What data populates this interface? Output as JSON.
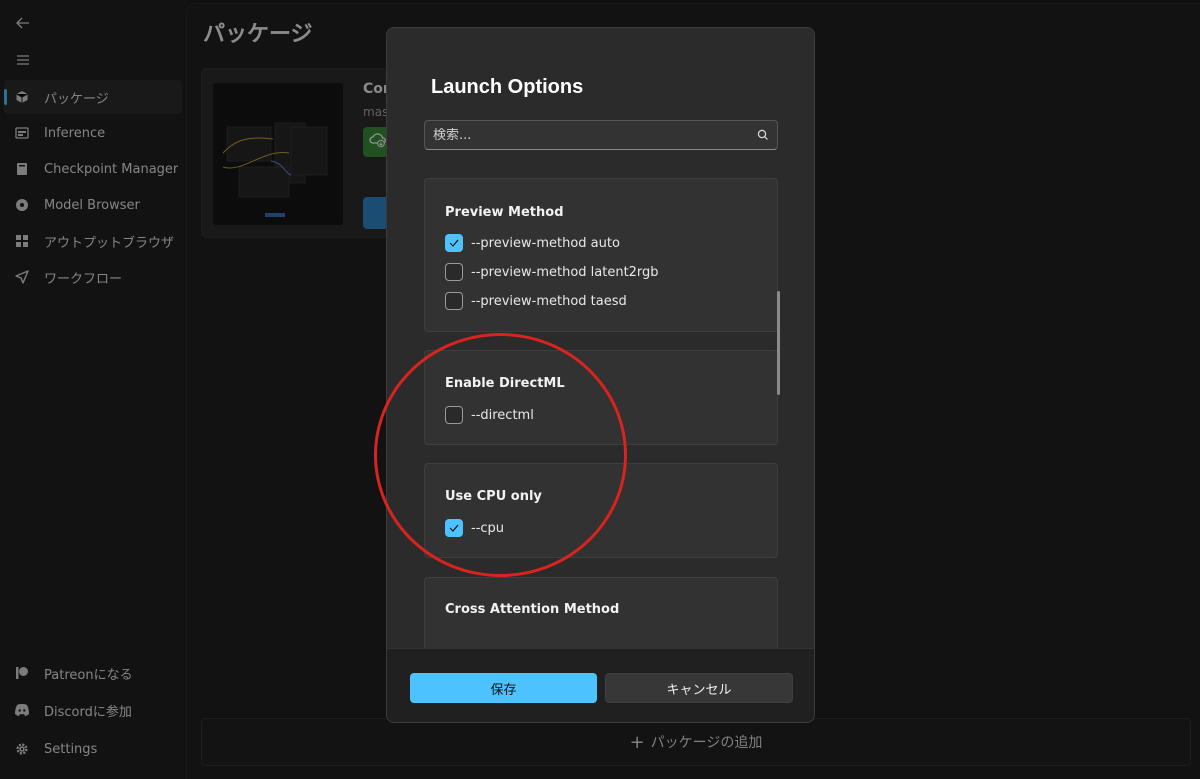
{
  "sidebar": {
    "items": [
      {
        "label": "パッケージ",
        "icon": "package-icon",
        "active": true
      },
      {
        "label": "Inference",
        "icon": "inference-icon",
        "active": false
      },
      {
        "label": "Checkpoint Manager",
        "icon": "checkpoint-icon",
        "active": false
      },
      {
        "label": "Model Browser",
        "icon": "model-browser-icon",
        "active": false
      },
      {
        "label": "アウトプットブラウザ",
        "icon": "output-browser-icon",
        "active": false
      },
      {
        "label": "ワークフロー",
        "icon": "workflow-icon",
        "active": false
      }
    ],
    "footer": [
      {
        "label": "Patreonになる",
        "icon": "patreon-icon"
      },
      {
        "label": "Discordに参加",
        "icon": "discord-icon"
      },
      {
        "label": "Settings",
        "icon": "gear-icon"
      }
    ]
  },
  "main": {
    "title": "パッケージ",
    "card": {
      "name": "Cor",
      "branch": "mas"
    },
    "add_package": "パッケージの追加"
  },
  "dialog": {
    "title": "Launch Options",
    "search_placeholder": "検索...",
    "groups": [
      {
        "title": "Preview Method",
        "options": [
          {
            "label": "--preview-method auto",
            "checked": true
          },
          {
            "label": "--preview-method latent2rgb",
            "checked": false
          },
          {
            "label": "--preview-method taesd",
            "checked": false
          }
        ]
      },
      {
        "title": "Enable DirectML",
        "options": [
          {
            "label": "--directml",
            "checked": false
          }
        ]
      },
      {
        "title": "Use CPU only",
        "options": [
          {
            "label": "--cpu",
            "checked": true
          }
        ]
      },
      {
        "title": "Cross Attention Method",
        "options": []
      }
    ],
    "save_label": "保存",
    "cancel_label": "キャンセル"
  },
  "colors": {
    "accent": "#4cc2ff",
    "annotation": "#d8231f",
    "update_green": "#3a8c3a"
  }
}
